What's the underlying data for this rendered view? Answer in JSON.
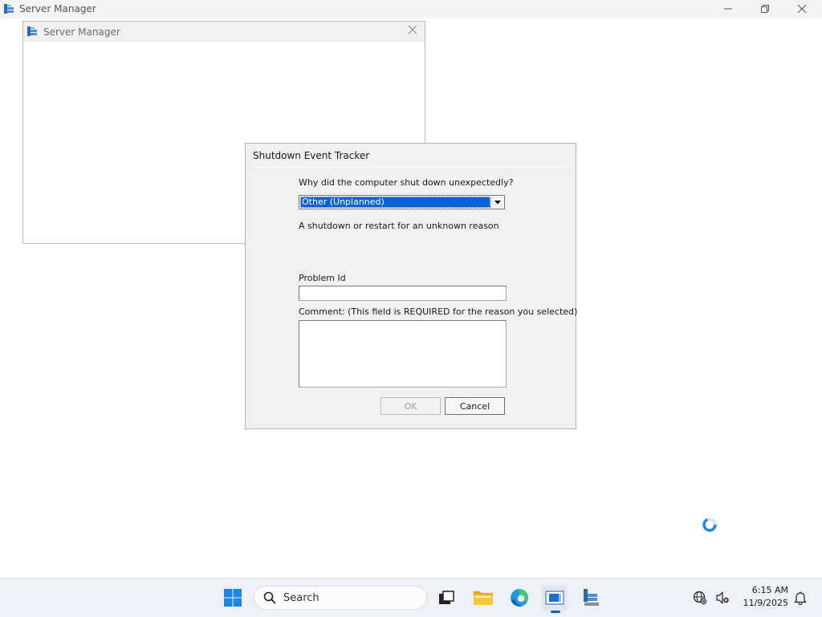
{
  "main_window": {
    "title": "Server Manager"
  },
  "inner_window": {
    "title": "Server Manager"
  },
  "dialog": {
    "title": "Shutdown Event Tracker",
    "question": "Why did the computer shut down unexpectedly?",
    "reason_selected": "Other (Unplanned)",
    "reason_description": "A shutdown or restart for an unknown reason",
    "problem_id_label": "Problem Id",
    "problem_id_value": "",
    "comment_label": "Comment: (This field is REQUIRED for the reason you selected)",
    "comment_value": "",
    "ok_label": "OK",
    "cancel_label": "Cancel"
  },
  "taskbar": {
    "search_placeholder": "Search",
    "time": "6:15 AM",
    "date": "11/9/2025"
  },
  "colors": {
    "accent": "#0a64d8",
    "taskbar_bg": "#eef0f5"
  }
}
